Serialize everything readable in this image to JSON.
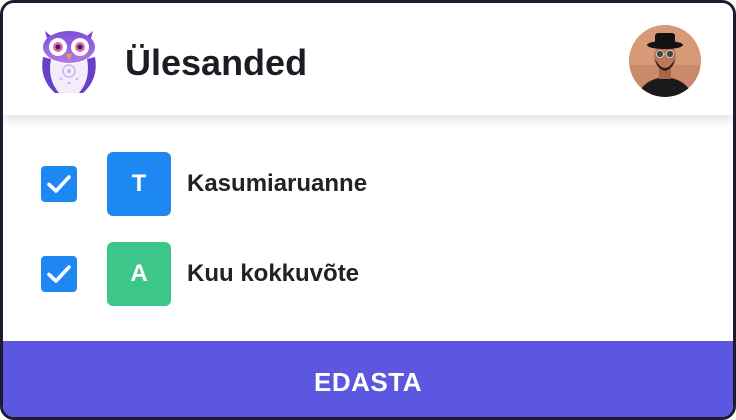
{
  "header": {
    "title": "Ülesanded",
    "logo_icon": "owl-icon",
    "avatar_icon": "user-avatar"
  },
  "tasks": [
    {
      "checked": true,
      "badge": "T",
      "badge_color": "#1e88f2",
      "label": "Kasumiaruanne"
    },
    {
      "checked": true,
      "badge": "A",
      "badge_color": "#3cc68a",
      "label": "Kuu kokkuvõte"
    }
  ],
  "footer": {
    "submit_label": "EDASTA",
    "submit_color": "#5c57e0"
  },
  "colors": {
    "checkbox": "#1e88f2",
    "border": "#1f1b2e"
  }
}
